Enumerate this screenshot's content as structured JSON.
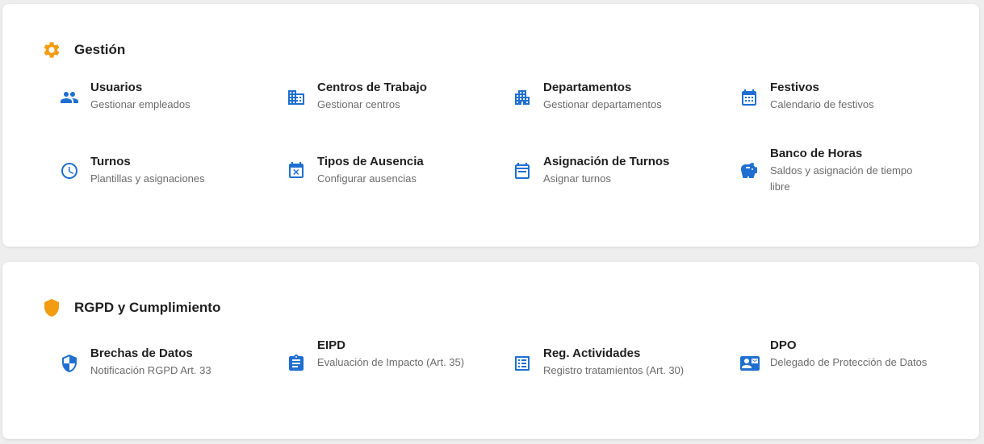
{
  "colors": {
    "accent_orange": "#f39c12",
    "icon_blue": "#1e6fd0",
    "title": "#1f1f1f",
    "subtitle": "#6b6b6b"
  },
  "sections": [
    {
      "title": "Gestión",
      "icon": "gear-icon",
      "items": [
        {
          "title": "Usuarios",
          "desc": "Gestionar empleados",
          "icon": "people-icon"
        },
        {
          "title": "Centros de Trabajo",
          "desc": "Gestionar centros",
          "icon": "building-icon"
        },
        {
          "title": "Departamentos",
          "desc": "Gestionar departamentos",
          "icon": "office-building-icon"
        },
        {
          "title": "Festivos",
          "desc": "Calendario de festivos",
          "icon": "calendar-icon"
        },
        {
          "title": "Turnos",
          "desc": "Plantillas y asignaciones",
          "icon": "clock-icon"
        },
        {
          "title": "Tipos de Ausencia",
          "desc": "Configurar ausencias",
          "icon": "calendar-x-icon"
        },
        {
          "title": "Asignación de Turnos",
          "desc": "Asignar turnos",
          "icon": "calendar-month-icon"
        },
        {
          "title": "Banco de Horas",
          "desc": "Saldos y asignación de tiempo libre",
          "icon": "piggy-bank-icon"
        }
      ]
    },
    {
      "title": "RGPD y Cumplimiento",
      "icon": "shield-icon",
      "items": [
        {
          "title": "Brechas de Datos",
          "desc": "Notificación RGPD Art. 33",
          "icon": "shield-user-icon"
        },
        {
          "title": "EIPD",
          "desc": "Evaluación de Impacto (Art. 35)",
          "icon": "clipboard-icon"
        },
        {
          "title": "Reg. Actividades",
          "desc": "Registro tratamientos (Art. 30)",
          "icon": "list-alt-icon"
        },
        {
          "title": "DPO",
          "desc": "Delegado de Protección de Datos",
          "icon": "contact-mail-icon"
        }
      ]
    }
  ]
}
